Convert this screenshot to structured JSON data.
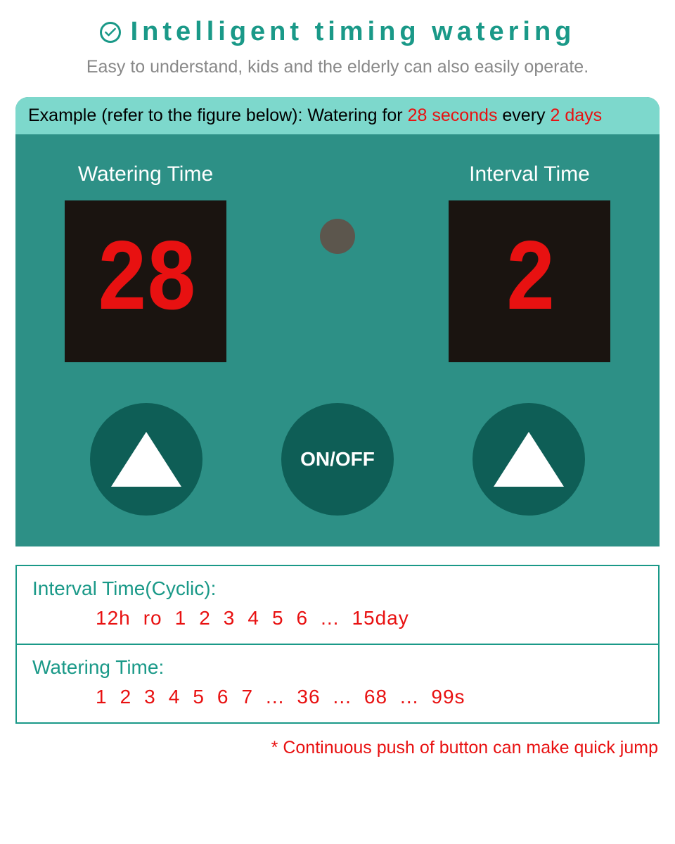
{
  "header": {
    "title": "Intelligent timing watering",
    "subtitle": "Easy to understand, kids and the elderly can also easily operate."
  },
  "example": {
    "prefix": "Example (refer to the figure below): Watering for ",
    "duration": "28 seconds",
    "mid": " every ",
    "interval": "2 days"
  },
  "displays": {
    "watering": {
      "label": "Watering Time",
      "value": "28"
    },
    "interval": {
      "label": "Interval Time",
      "value": "2"
    }
  },
  "buttons": {
    "onoff": "ON/OFF"
  },
  "info": {
    "interval": {
      "label": "Interval Time(Cyclic):",
      "values": [
        "12h",
        "ro",
        "1",
        "2",
        "3",
        "4",
        "5",
        "6",
        "...",
        "15day"
      ]
    },
    "watering": {
      "label": "Watering Time:",
      "values": [
        "1",
        "2",
        "3",
        "4",
        "5",
        "6",
        "7",
        "...",
        "36",
        "...",
        "68",
        "...",
        "99s"
      ]
    }
  },
  "footnote": "* Continuous push of button can make quick jump"
}
